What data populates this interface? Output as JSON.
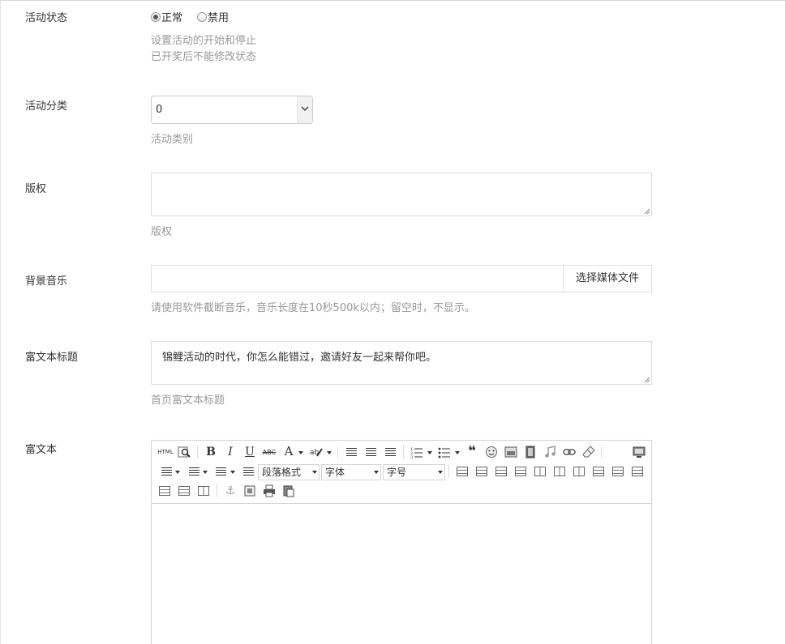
{
  "status": {
    "label": "活动状态",
    "options": [
      "正常",
      "禁用"
    ],
    "selected": "正常",
    "help1": "设置活动的开始和停止",
    "help2": "已开奖后不能修改状态"
  },
  "category": {
    "label": "活动分类",
    "value": "0",
    "help": "活动类别"
  },
  "copyright": {
    "label": "版权",
    "value": "",
    "help": "版权"
  },
  "music": {
    "label": "背景音乐",
    "value": "",
    "button": "选择媒体文件",
    "help": "请使用软件截断音乐，音乐长度在10秒500k以内；留空时，不显示。"
  },
  "richTitle": {
    "label": "富文本标题",
    "value": "锦鲤活动的时代，你怎么能错过，邀请好友一起来帮你吧。",
    "help": "首页富文本标题"
  },
  "richText": {
    "label": "富文本",
    "toolbar": {
      "html_label": "HTML",
      "bold": "B",
      "italic": "I",
      "underline": "U",
      "strike": "ABC",
      "fontcolor": "A",
      "paragraph": "段落格式",
      "fontfamily": "字体",
      "fontsize": "字号"
    }
  }
}
